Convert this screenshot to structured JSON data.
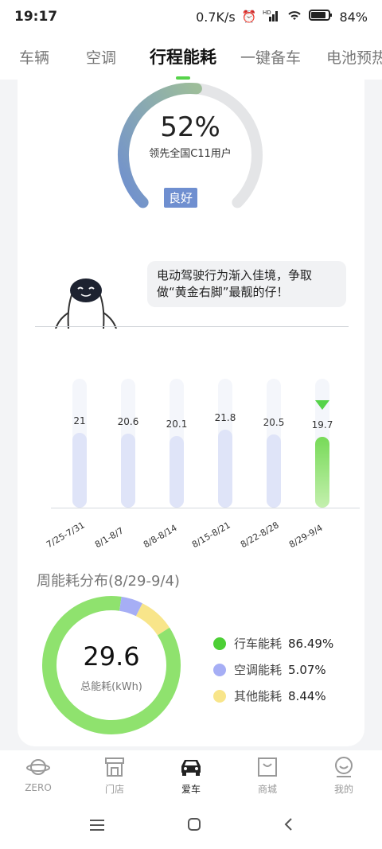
{
  "status_bar": {
    "time": "19:17",
    "network_speed": "0.7K/s",
    "battery": "84%",
    "icons": [
      "alarm-icon",
      "hd-signal-icon",
      "wifi-icon",
      "battery-icon"
    ]
  },
  "tabs": [
    {
      "label": "车辆",
      "active": false
    },
    {
      "label": "空调",
      "active": false
    },
    {
      "label": "行程能耗",
      "active": true
    },
    {
      "label": "一键备车",
      "active": false
    },
    {
      "label": "电池预热",
      "active": false
    }
  ],
  "gauge": {
    "percent": "52%",
    "percent_value": 52,
    "subtitle": "领先全国C11用户",
    "grade": "良好"
  },
  "tip": {
    "text_line1": "电动驾驶行为渐入佳境，争取",
    "text_line2": "做“黄金右脚”最靓的仔！"
  },
  "chart_data": {
    "type": "bar",
    "categories": [
      "7/25-7/31",
      "8/1-8/7",
      "8/8-8/14",
      "8/15-8/21",
      "8/22-8/28",
      "8/29-9/4"
    ],
    "values": [
      21,
      20.6,
      20.1,
      21.8,
      20.5,
      19.7
    ],
    "value_labels": [
      "21",
      "20.6",
      "20.1",
      "21.8",
      "20.5",
      "19.7"
    ],
    "highlight_index": 5,
    "title": "",
    "xlabel": "",
    "ylabel": "",
    "ylim": [
      0,
      36
    ],
    "colors": {
      "normal": "#dfe4f8",
      "highlight": "#77da58"
    }
  },
  "distribution": {
    "title": "周能耗分布(8/29-9/4)",
    "total_value": "29.6",
    "total_label": "总能耗(kWh)",
    "items": [
      {
        "name": "行车能耗",
        "value": "86.49%",
        "fraction": 0.8649,
        "color": "#8fe26e",
        "dot_color": "#4ccf35"
      },
      {
        "name": "空调能耗",
        "value": "5.07%",
        "fraction": 0.0507,
        "color": "#a6aef5",
        "dot_color": "#a6aef5"
      },
      {
        "name": "其他能耗",
        "value": "8.44%",
        "fraction": 0.0844,
        "color": "#f8e58a",
        "dot_color": "#f8e58a"
      }
    ]
  },
  "bottom_nav": [
    {
      "label": "ZERO",
      "icon": "planet-icon",
      "active": false
    },
    {
      "label": "门店",
      "icon": "store-icon",
      "active": false
    },
    {
      "label": "爱车",
      "icon": "car-icon",
      "active": true
    },
    {
      "label": "商城",
      "icon": "shopping-bag-icon",
      "active": false
    },
    {
      "label": "我的",
      "icon": "profile-icon",
      "active": false
    }
  ],
  "system_nav": {
    "icons": [
      "menu-icon",
      "home-icon",
      "back-icon"
    ]
  }
}
